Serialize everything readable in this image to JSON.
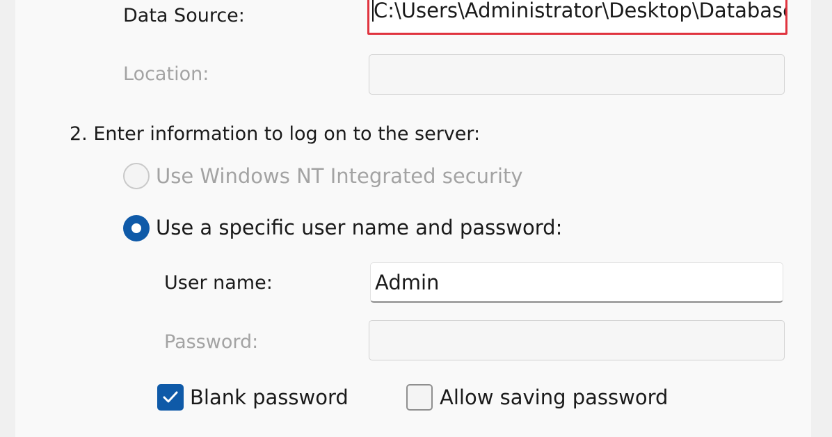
{
  "section1": {
    "data_source_label": "Data Source:",
    "data_source_value": "C:\\Users\\Administrator\\Desktop\\Database",
    "location_label": "Location:",
    "location_value": ""
  },
  "section2": {
    "heading": "2. Enter information to log on to the server:",
    "option_nt_security": "Use Windows NT Integrated security",
    "option_specific_user": "Use a specific user name and password:",
    "username_label": "User name:",
    "username_value": "Admin",
    "password_label": "Password:",
    "password_value": "",
    "blank_password_label": "Blank password",
    "allow_saving_label": "Allow saving password"
  },
  "state": {
    "selected_option": "specific_user",
    "blank_password_checked": true,
    "allow_saving_checked": false
  },
  "colors": {
    "accent": "#0f5aa8",
    "highlight_border": "#e0343f",
    "disabled_text": "#a3a3a3"
  }
}
